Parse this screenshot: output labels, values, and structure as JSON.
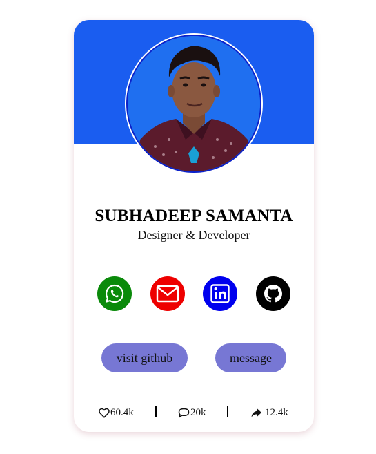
{
  "profile": {
    "name": "SUBHADEEP SAMANTA",
    "role": "Designer & Developer"
  },
  "social": [
    {
      "icon": "whatsapp-icon",
      "color": "#0a8a0a"
    },
    {
      "icon": "mail-icon",
      "color": "#ee0000"
    },
    {
      "icon": "linkedin-icon",
      "color": "#0000ee"
    },
    {
      "icon": "github-icon",
      "color": "#000000"
    }
  ],
  "buttons": {
    "github_label": "visit github",
    "message_label": "message"
  },
  "stats": {
    "likes": "60.4k",
    "comments": "20k",
    "shares": "12.4k"
  },
  "colors": {
    "header": "#1a5df0",
    "button": "#7777d4"
  }
}
